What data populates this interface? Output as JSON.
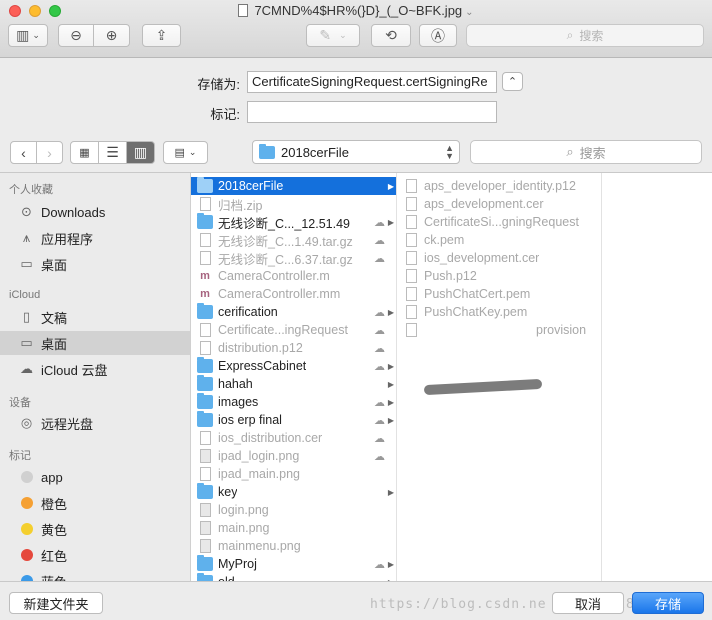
{
  "window": {
    "title": "7CMND%4$HR%(}D}_(_O~BFK.jpg"
  },
  "toolbar": {
    "search_placeholder": "搜索"
  },
  "save_sheet": {
    "save_as_label": "存储为:",
    "save_as_value": "CertificateSigningRequest.certSigningRe",
    "tags_label": "标记:",
    "tags_value": "",
    "current_folder": "2018cerFile",
    "search_placeholder": "搜索"
  },
  "sidebar": {
    "favorites_header": "个人收藏",
    "favorites": [
      {
        "label": "Downloads",
        "icon": "download-icon"
      },
      {
        "label": "应用程序",
        "icon": "applications-icon"
      },
      {
        "label": "桌面",
        "icon": "desktop-icon"
      }
    ],
    "icloud_header": "iCloud",
    "icloud": [
      {
        "label": "文稿",
        "icon": "document-icon"
      },
      {
        "label": "桌面",
        "icon": "desktop-icon"
      },
      {
        "label": "iCloud 云盘",
        "icon": "cloud-icon"
      }
    ],
    "devices_header": "设备",
    "devices": [
      {
        "label": "远程光盘",
        "icon": "disc-icon"
      }
    ],
    "tags_header": "标记",
    "tags": [
      {
        "label": "app",
        "color": "#d0d0d0"
      },
      {
        "label": "橙色",
        "color": "#f5a033"
      },
      {
        "label": "黄色",
        "color": "#f4cf2e"
      },
      {
        "label": "红色",
        "color": "#e5483c"
      },
      {
        "label": "蓝色",
        "color": "#3b9ae8"
      }
    ]
  },
  "column1": [
    {
      "name": "2018cerFile",
      "type": "folder",
      "selected": true,
      "cloud": false,
      "chevron": true,
      "dim": false
    },
    {
      "name": "归档.zip",
      "type": "doc",
      "selected": false,
      "cloud": false,
      "chevron": false,
      "dim": true
    },
    {
      "name": "无线诊断_C..._12.51.49",
      "type": "folder",
      "selected": false,
      "cloud": true,
      "chevron": true,
      "dim": false
    },
    {
      "name": "无线诊断_C...1.49.tar.gz",
      "type": "doc",
      "selected": false,
      "cloud": true,
      "chevron": false,
      "dim": true
    },
    {
      "name": "无线诊断_C...6.37.tar.gz",
      "type": "doc",
      "selected": false,
      "cloud": true,
      "chevron": false,
      "dim": true
    },
    {
      "name": "CameraController.m",
      "type": "m",
      "selected": false,
      "cloud": false,
      "chevron": false,
      "dim": true
    },
    {
      "name": "CameraController.mm",
      "type": "m",
      "selected": false,
      "cloud": false,
      "chevron": false,
      "dim": true
    },
    {
      "name": "cerification",
      "type": "folder",
      "selected": false,
      "cloud": true,
      "chevron": true,
      "dim": false
    },
    {
      "name": "Certificate...ingRequest",
      "type": "doc",
      "selected": false,
      "cloud": true,
      "chevron": false,
      "dim": true
    },
    {
      "name": "distribution.p12",
      "type": "doc",
      "selected": false,
      "cloud": true,
      "chevron": false,
      "dim": true
    },
    {
      "name": "ExpressCabinet",
      "type": "folder",
      "selected": false,
      "cloud": true,
      "chevron": true,
      "dim": false
    },
    {
      "name": "hahah",
      "type": "folder",
      "selected": false,
      "cloud": false,
      "chevron": true,
      "dim": false
    },
    {
      "name": "images",
      "type": "folder",
      "selected": false,
      "cloud": true,
      "chevron": true,
      "dim": false
    },
    {
      "name": "ios erp final",
      "type": "folder",
      "selected": false,
      "cloud": true,
      "chevron": true,
      "dim": false
    },
    {
      "name": "ios_distribution.cer",
      "type": "doc",
      "selected": false,
      "cloud": true,
      "chevron": false,
      "dim": true
    },
    {
      "name": "ipad_login.png",
      "type": "img",
      "selected": false,
      "cloud": true,
      "chevron": false,
      "dim": true
    },
    {
      "name": "ipad_main.png",
      "type": "doc",
      "selected": false,
      "cloud": false,
      "chevron": false,
      "dim": true
    },
    {
      "name": "key",
      "type": "folder",
      "selected": false,
      "cloud": false,
      "chevron": true,
      "dim": false
    },
    {
      "name": "login.png",
      "type": "img",
      "selected": false,
      "cloud": false,
      "chevron": false,
      "dim": true
    },
    {
      "name": "main.png",
      "type": "img",
      "selected": false,
      "cloud": false,
      "chevron": false,
      "dim": true
    },
    {
      "name": "mainmenu.png",
      "type": "img",
      "selected": false,
      "cloud": false,
      "chevron": false,
      "dim": true
    },
    {
      "name": "MyProj",
      "type": "folder",
      "selected": false,
      "cloud": true,
      "chevron": true,
      "dim": false
    },
    {
      "name": "old",
      "type": "folder",
      "selected": false,
      "cloud": true,
      "chevron": true,
      "dim": false
    }
  ],
  "column2": [
    {
      "name": "aps_developer_identity.p12",
      "type": "doc"
    },
    {
      "name": "aps_development.cer",
      "type": "doc"
    },
    {
      "name": "CertificateSi...gningRequest",
      "type": "doc"
    },
    {
      "name": "ck.pem",
      "type": "doc"
    },
    {
      "name": "ios_development.cer",
      "type": "doc"
    },
    {
      "name": "Push.p12",
      "type": "doc"
    },
    {
      "name": "PushChatCert.pem",
      "type": "doc"
    },
    {
      "name": "PushChatKey.pem",
      "type": "doc"
    },
    {
      "name": "provision",
      "type": "provision"
    }
  ],
  "buttons": {
    "new_folder": "新建文件夹",
    "cancel": "取消",
    "save": "存储"
  },
  "watermark": "https://blog.csdn.ne  q_3351  18",
  "colors": {
    "selection": "#1470dc",
    "primary_button": "#1a76ea",
    "folder": "#5fb1ec"
  }
}
